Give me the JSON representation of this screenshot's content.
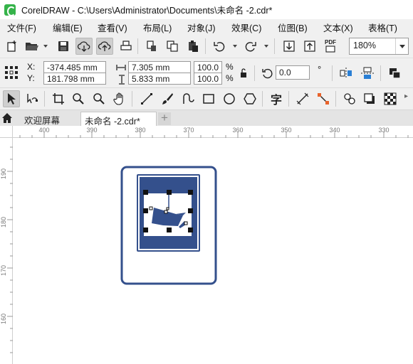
{
  "window": {
    "title": "CorelDRAW - C:\\Users\\Administrator\\Documents\\未命名 -2.cdr*"
  },
  "menu": {
    "file": "文件(F)",
    "edit": "编辑(E)",
    "view": "查看(V)",
    "layout": "布局(L)",
    "object": "对象(J)",
    "effects": "效果(C)",
    "bitmaps": "位图(B)",
    "text": "文本(X)",
    "table": "表格(T)"
  },
  "toolbar": {
    "zoom_level": "180%",
    "pdf_label": "PDF"
  },
  "property_bar": {
    "x_label": "X:",
    "x_value": "-374.485 mm",
    "y_label": "Y:",
    "y_value": "181.798 mm",
    "width_value": "7.305 mm",
    "height_value": "5.833 mm",
    "scale_x": "100.0",
    "scale_y": "100.0",
    "percent": "%",
    "rotation": "0.0",
    "degree": "°"
  },
  "toolbox": {
    "text_tool_glyph": "字"
  },
  "tabs": [
    {
      "label": "欢迎屏幕"
    },
    {
      "label": "未命名 -2.cdr*"
    }
  ],
  "ruler": {
    "top": [
      "400",
      "390",
      "380",
      "370",
      "360",
      "350",
      "340",
      "330"
    ],
    "left": [
      "190",
      "180",
      "170",
      "160"
    ]
  },
  "colors": {
    "sign_blue": "#34508c",
    "menu_bg": "#f0f0f0",
    "tab_active_bg": "#ffffff"
  }
}
